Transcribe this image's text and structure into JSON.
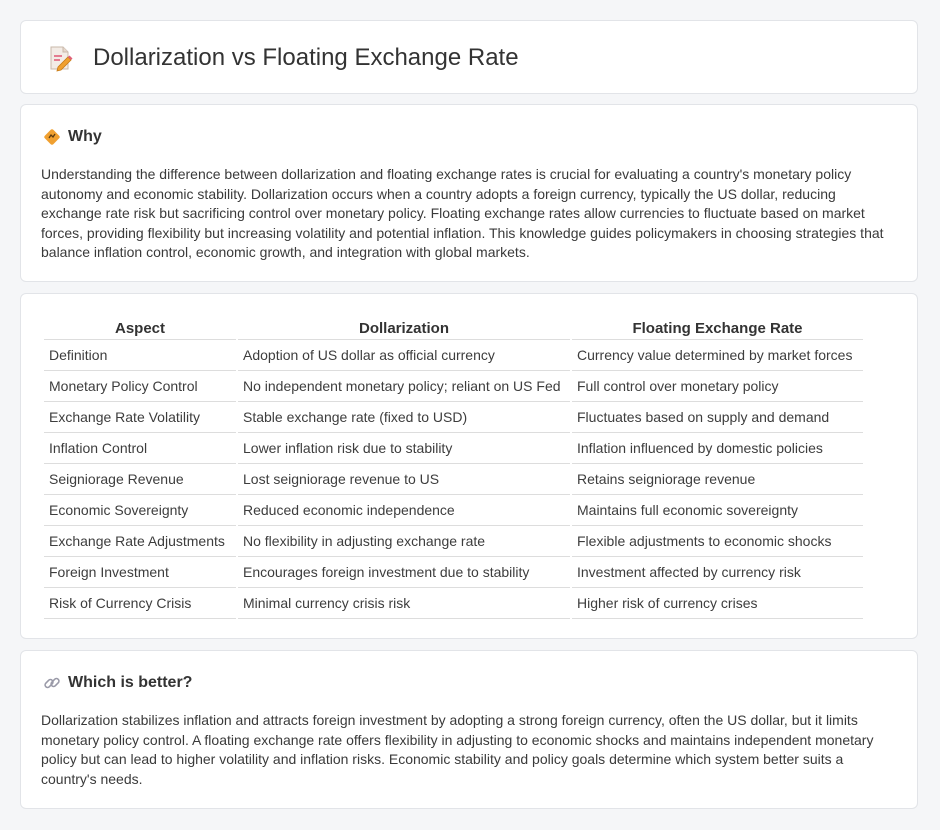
{
  "header": {
    "title": "Dollarization vs Floating Exchange Rate",
    "icon": "document-pencil-icon"
  },
  "why": {
    "icon": "diamond-sign-icon",
    "heading": "Why",
    "text": "Understanding the difference between dollarization and floating exchange rates is crucial for evaluating a country's monetary policy autonomy and economic stability. Dollarization occurs when a country adopts a foreign currency, typically the US dollar, reducing exchange rate risk but sacrificing control over monetary policy. Floating exchange rates allow currencies to fluctuate based on market forces, providing flexibility but increasing volatility and potential inflation. This knowledge guides policymakers in choosing strategies that balance inflation control, economic growth, and integration with global markets."
  },
  "comparison": {
    "headers": [
      "Aspect",
      "Dollarization",
      "Floating Exchange Rate"
    ],
    "rows": [
      [
        "Definition",
        "Adoption of US dollar as official currency",
        "Currency value determined by market forces"
      ],
      [
        "Monetary Policy Control",
        "No independent monetary policy; reliant on US Fed",
        "Full control over monetary policy"
      ],
      [
        "Exchange Rate Volatility",
        "Stable exchange rate (fixed to USD)",
        "Fluctuates based on supply and demand"
      ],
      [
        "Inflation Control",
        "Lower inflation risk due to stability",
        "Inflation influenced by domestic policies"
      ],
      [
        "Seigniorage Revenue",
        "Lost seigniorage revenue to US",
        "Retains seigniorage revenue"
      ],
      [
        "Economic Sovereignty",
        "Reduced economic independence",
        "Maintains full economic sovereignty"
      ],
      [
        "Exchange Rate Adjustments",
        "No flexibility in adjusting exchange rate",
        "Flexible adjustments to economic shocks"
      ],
      [
        "Foreign Investment",
        "Encourages foreign investment due to stability",
        "Investment affected by currency risk"
      ],
      [
        "Risk of Currency Crisis",
        "Minimal currency crisis risk",
        "Higher risk of currency crises"
      ]
    ]
  },
  "better": {
    "icon": "link-icon",
    "heading": "Which is better?",
    "text": "Dollarization stabilizes inflation and attracts foreign investment by adopting a strong foreign currency, often the US dollar, but it limits monetary policy control. A floating exchange rate offers flexibility in adjusting to economic shocks and maintains independent monetary policy but can lead to higher volatility and inflation risks. Economic stability and policy goals determine which system better suits a country's needs."
  },
  "colors": {
    "background": "#f5f6f8",
    "card": "#ffffff",
    "border": "#e2e4e8",
    "text": "#333333",
    "icon_orange": "#f0a030",
    "icon_pink": "#e0607a"
  }
}
